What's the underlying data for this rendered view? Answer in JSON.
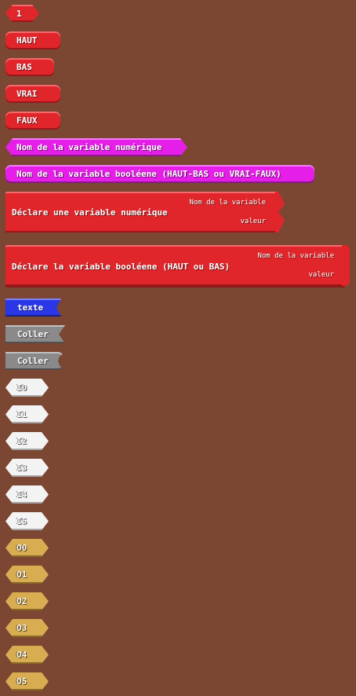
{
  "blocks": {
    "one": "1",
    "haut": "HAUT",
    "bas": "BAS",
    "vrai": "VRAI",
    "faux": "FAUX",
    "var_num_name": "Nom de la variable numérique",
    "var_bool_name": "Nom de la variable booléene (HAUT-BAS ou VRAI-FAUX)",
    "declare_num": {
      "title": "Déclare une variable numérique",
      "field_name": "Nom de la variable",
      "field_value": "valeur"
    },
    "declare_bool": {
      "title": "Déclare la variable booléene (HAUT ou BAS)",
      "field_name": "Nom de la variable",
      "field_value": "valeur"
    },
    "texte": "texte",
    "coller_1": "Coller",
    "coller_2": "Coller",
    "inputs": [
      "I0",
      "I1",
      "I2",
      "I3",
      "I4",
      "I5"
    ],
    "outputs": [
      "O0",
      "O1",
      "O2",
      "O3",
      "O4",
      "O5"
    ]
  },
  "colors": {
    "background": "#7b4632",
    "logic_red": "#e0262b",
    "variable_magenta": "#e51fe8",
    "text_blue": "#2a37e6",
    "paste_gray": "#8a8a8a",
    "input_white": "#f3f3f3",
    "output_gold": "#d8ad52"
  }
}
